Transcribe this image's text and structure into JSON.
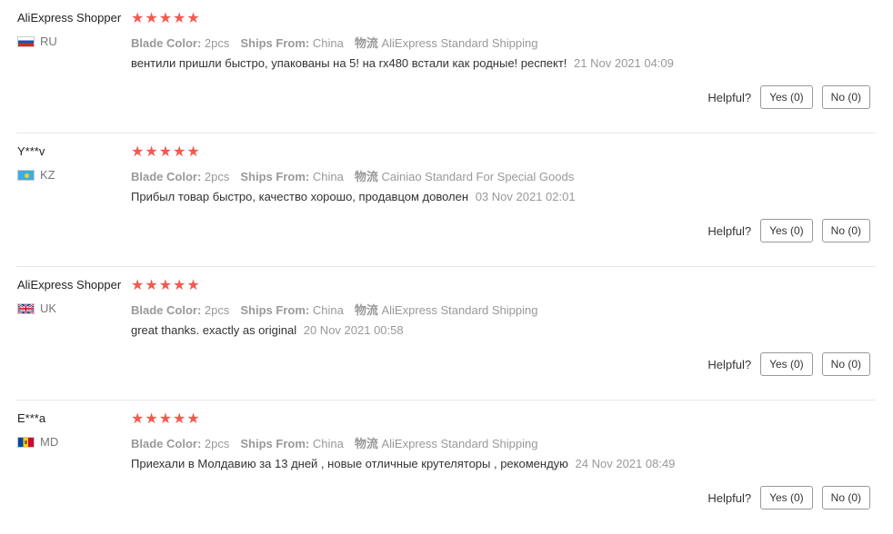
{
  "reviews": [
    {
      "user": "AliExpress Shopper",
      "country": "RU",
      "flag": "russia-flag",
      "stars": 5,
      "attrs": [
        {
          "key": "Blade Color:",
          "value": "2pcs"
        },
        {
          "key": "Ships From:",
          "value": "China"
        },
        {
          "key": "物流",
          "value": "AliExpress Standard Shipping"
        }
      ],
      "text": "вентили пришли быстро, упакованы на 5! на rx480 встали как родные! респект!",
      "date": "21 Nov 2021 04:09",
      "helpful_label": "Helpful?",
      "yes_label": "Yes (0)",
      "no_label": "No (0)"
    },
    {
      "user": "Y***v",
      "country": "KZ",
      "flag": "kazakhstan-flag",
      "stars": 5,
      "attrs": [
        {
          "key": "Blade Color:",
          "value": "2pcs"
        },
        {
          "key": "Ships From:",
          "value": "China"
        },
        {
          "key": "物流",
          "value": "Cainiao Standard For Special Goods"
        }
      ],
      "text": "Прибыл товар быстро, качество хорошо, продавцом доволен",
      "date": "03 Nov 2021 02:01",
      "helpful_label": "Helpful?",
      "yes_label": "Yes (0)",
      "no_label": "No (0)"
    },
    {
      "user": "AliExpress Shopper",
      "country": "UK",
      "flag": "uk-flag",
      "stars": 5,
      "attrs": [
        {
          "key": "Blade Color:",
          "value": "2pcs"
        },
        {
          "key": "Ships From:",
          "value": "China"
        },
        {
          "key": "物流",
          "value": "AliExpress Standard Shipping"
        }
      ],
      "text": "great thanks. exactly as original",
      "date": "20 Nov 2021 00:58",
      "helpful_label": "Helpful?",
      "yes_label": "Yes (0)",
      "no_label": "No (0)"
    },
    {
      "user": "E***a",
      "country": "MD",
      "flag": "moldova-flag",
      "stars": 5,
      "attrs": [
        {
          "key": "Blade Color:",
          "value": "2pcs"
        },
        {
          "key": "Ships From:",
          "value": "China"
        },
        {
          "key": "物流",
          "value": "AliExpress Standard Shipping"
        }
      ],
      "text": "Приехали в Молдавию за 13 дней , новые отличные крутеляторы , рекомендую",
      "date": "24 Nov 2021 08:49",
      "helpful_label": "Helpful?",
      "yes_label": "Yes (0)",
      "no_label": "No (0)"
    }
  ],
  "colors": {
    "star": "#f25a4f",
    "muted": "#999999",
    "text": "#333333",
    "separator": "#e8e8e8"
  }
}
